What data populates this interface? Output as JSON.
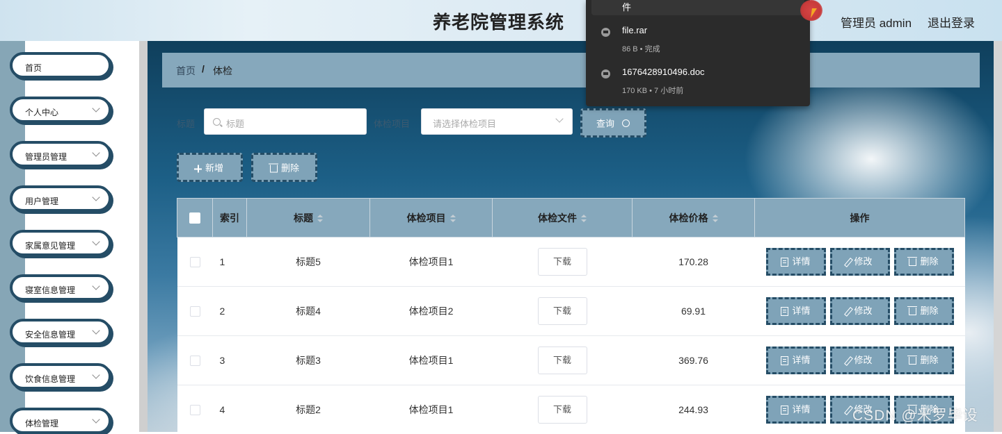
{
  "header": {
    "title": "养老院管理系统",
    "user": "管理员 admin",
    "logout": "退出登录"
  },
  "sidebar": {
    "items": [
      {
        "label": "首页",
        "has_arrow": false
      },
      {
        "label": "个人中心",
        "has_arrow": true
      },
      {
        "label": "管理员管理",
        "has_arrow": true
      },
      {
        "label": "用户管理",
        "has_arrow": true
      },
      {
        "label": "家属意见管理",
        "has_arrow": true
      },
      {
        "label": "寝室信息管理",
        "has_arrow": true
      },
      {
        "label": "安全信息管理",
        "has_arrow": true
      },
      {
        "label": "饮食信息管理",
        "has_arrow": true
      },
      {
        "label": "体检管理",
        "has_arrow": true
      }
    ]
  },
  "breadcrumb": {
    "home": "首页",
    "separator": "/",
    "current": "体检"
  },
  "filters": {
    "title_label": "标题",
    "title_placeholder": "标题",
    "item_label": "体检项目",
    "item_placeholder": "请选择体检项目",
    "query_button": "查询"
  },
  "actions": {
    "add": "新增",
    "delete": "删除"
  },
  "table": {
    "columns": [
      "索引",
      "标题",
      "体检项目",
      "体检文件",
      "体检价格",
      "操作"
    ],
    "rows": [
      {
        "index": "1",
        "title": "标题5",
        "item": "体检项目1",
        "file": "下载",
        "price": "170.28"
      },
      {
        "index": "2",
        "title": "标题4",
        "item": "体检项目2",
        "file": "下载",
        "price": "69.91"
      },
      {
        "index": "3",
        "title": "标题3",
        "item": "体检项目1",
        "file": "下载",
        "price": "369.76"
      },
      {
        "index": "4",
        "title": "标题2",
        "item": "体检项目1",
        "file": "下载",
        "price": "244.93"
      }
    ],
    "row_actions": {
      "detail": "详情",
      "edit": "修改",
      "delete": "删除"
    }
  },
  "downloads": {
    "partial_item": "件",
    "items": [
      {
        "name": "file.rar",
        "meta": "86 B • 完成"
      },
      {
        "name": "1676428910496.doc",
        "meta": "170 KB • 7 小时前"
      }
    ]
  },
  "watermark": "CSDN @米罗毕设",
  "colors": {
    "accent": "#86a8bc",
    "dark_border": "#254d66",
    "button_fill": "#7fa3b8"
  },
  "icons": {
    "search": "search-icon",
    "chevron": "chevron-down-icon",
    "plus": "plus-icon",
    "trash": "trash-icon",
    "detail": "document-icon",
    "edit": "pencil-icon",
    "sort": "sort-icon",
    "file": "file-icon"
  }
}
